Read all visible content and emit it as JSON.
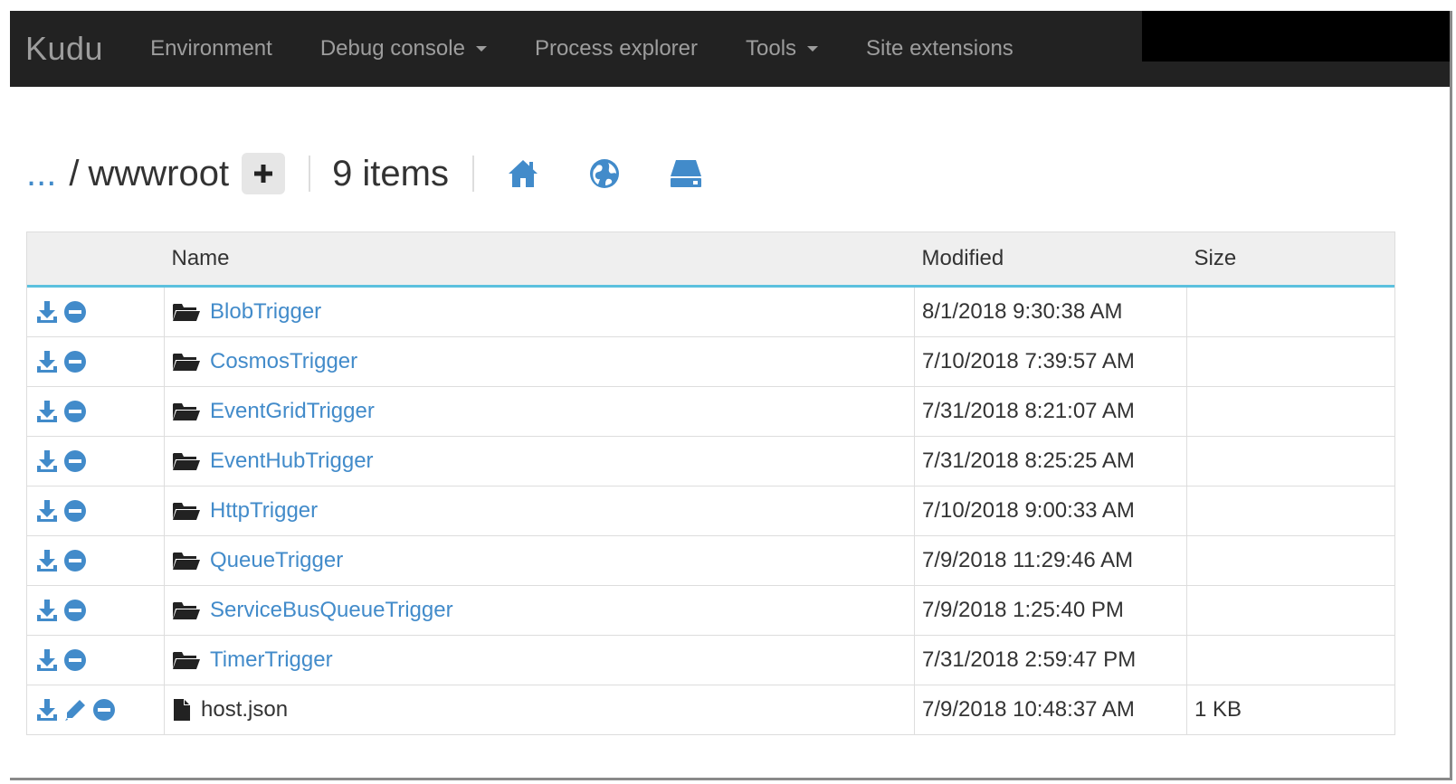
{
  "nav": {
    "brand": "Kudu",
    "items": [
      {
        "label": "Environment",
        "dropdown": false
      },
      {
        "label": "Debug console",
        "dropdown": true
      },
      {
        "label": "Process explorer",
        "dropdown": false
      },
      {
        "label": "Tools",
        "dropdown": true
      },
      {
        "label": "Site extensions",
        "dropdown": false
      }
    ]
  },
  "breadcrumb": {
    "ellipsis": "...",
    "separator": "/",
    "current": "wwwroot",
    "count": "9 items"
  },
  "table": {
    "headers": [
      "",
      "Name",
      "Modified",
      "Size"
    ],
    "rows": [
      {
        "name": "BlobTrigger",
        "type": "folder",
        "modified": "8/1/2018 9:30:38 AM",
        "size": ""
      },
      {
        "name": "CosmosTrigger",
        "type": "folder",
        "modified": "7/10/2018 7:39:57 AM",
        "size": ""
      },
      {
        "name": "EventGridTrigger",
        "type": "folder",
        "modified": "7/31/2018 8:21:07 AM",
        "size": ""
      },
      {
        "name": "EventHubTrigger",
        "type": "folder",
        "modified": "7/31/2018 8:25:25 AM",
        "size": ""
      },
      {
        "name": "HttpTrigger",
        "type": "folder",
        "modified": "7/10/2018 9:00:33 AM",
        "size": ""
      },
      {
        "name": "QueueTrigger",
        "type": "folder",
        "modified": "7/9/2018 11:29:46 AM",
        "size": ""
      },
      {
        "name": "ServiceBusQueueTrigger",
        "type": "folder",
        "modified": "7/9/2018 1:25:40 PM",
        "size": ""
      },
      {
        "name": "TimerTrigger",
        "type": "folder",
        "modified": "7/31/2018 2:59:47 PM",
        "size": ""
      },
      {
        "name": "host.json",
        "type": "file",
        "modified": "7/9/2018 10:48:37 AM",
        "size": "1 KB"
      }
    ]
  },
  "colors": {
    "navbar": "#222222",
    "nav_text": "#9d9d9d",
    "accent": "#428bca",
    "header_underline": "#5bc0de"
  },
  "icons": {
    "header": [
      "plus-icon",
      "home-icon",
      "globe-icon",
      "drive-icon"
    ],
    "row_actions_folder": [
      "download-icon",
      "delete-icon"
    ],
    "row_actions_file": [
      "download-icon",
      "edit-icon",
      "delete-icon"
    ]
  }
}
